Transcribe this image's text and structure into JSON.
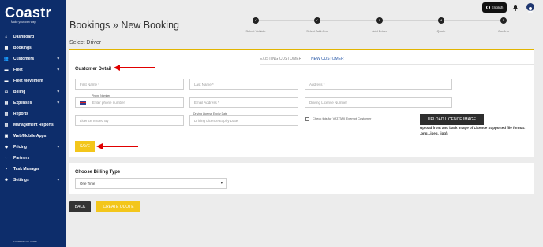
{
  "brand": {
    "logo": "Coastr",
    "tagline": "Make your own way"
  },
  "sidebar": {
    "items": [
      {
        "label": "Dashboard",
        "icon": "home-icon",
        "caret": false
      },
      {
        "label": "Bookings",
        "icon": "calendar-icon",
        "caret": false
      },
      {
        "label": "Customers",
        "icon": "users-icon",
        "caret": true
      },
      {
        "label": "Fleet",
        "icon": "car-icon",
        "caret": true
      },
      {
        "label": "Fleet Movement",
        "icon": "car-icon",
        "caret": false
      },
      {
        "label": "Billing",
        "icon": "card-icon",
        "caret": true
      },
      {
        "label": "Expenses",
        "icon": "receipt-icon",
        "caret": true
      },
      {
        "label": "Reports",
        "icon": "report-icon",
        "caret": false
      },
      {
        "label": "Management Reports",
        "icon": "report-icon",
        "caret": false
      },
      {
        "label": "Web/Mobile Apps",
        "icon": "app-icon",
        "caret": false
      },
      {
        "label": "Pricing",
        "icon": "tag-icon",
        "caret": true
      },
      {
        "label": "Partners",
        "icon": "partner-icon",
        "caret": false
      },
      {
        "label": "Task Manager",
        "icon": "task-icon",
        "caret": false
      },
      {
        "label": "Settings",
        "icon": "gear-icon",
        "caret": true
      }
    ],
    "powered_by": "POWERED BY Coastr"
  },
  "topbar": {
    "language": "English"
  },
  "page": {
    "title": "Bookings » New Booking",
    "subtitle": "Select Driver"
  },
  "stepper": {
    "steps": [
      {
        "label": "Select Vehicle",
        "marker": "✓"
      },
      {
        "label": "Select Add-Ons",
        "marker": "✓"
      },
      {
        "label": "Add Driver",
        "marker": "3"
      },
      {
        "label": "Quote",
        "marker": "4"
      },
      {
        "label": "Confirm",
        "marker": "5"
      }
    ]
  },
  "tabs": {
    "existing": "EXISTING CUSTOMER",
    "new": "NEW CUSTOMER"
  },
  "customer": {
    "section_title": "Customer Detail",
    "first_name": "First Name *",
    "last_name": "Last Name *",
    "address": "Address *",
    "phone_label": "Phone Number",
    "phone_placeholder": "Enter phone number",
    "email": "Email Address *",
    "license_number": "Driving License Number",
    "license_issued": "Licence Issued By",
    "license_expiry_label": "Driving License Expiry Date",
    "license_expiry_placeholder": "Driving Licence Expiry Date",
    "vat_checkbox": "Check this for VAT/TAX Exempt Customer",
    "upload_button": "UPLOAD LICENCE IMAGE",
    "upload_note": "Upload front and back image of Licence Supported file format: .png, .jpeg, .jpg).",
    "save_button": "SAVE"
  },
  "billing": {
    "section_title": "Choose Billing Type",
    "selected": "One Time"
  },
  "actions": {
    "back": "BACK",
    "create_quote": "CREATE QUOTE"
  },
  "colors": {
    "sidebar": "#0d2d6b",
    "accent": "#f3c61b",
    "annotation": "#e00000",
    "tab_active": "#2a5aa8"
  }
}
